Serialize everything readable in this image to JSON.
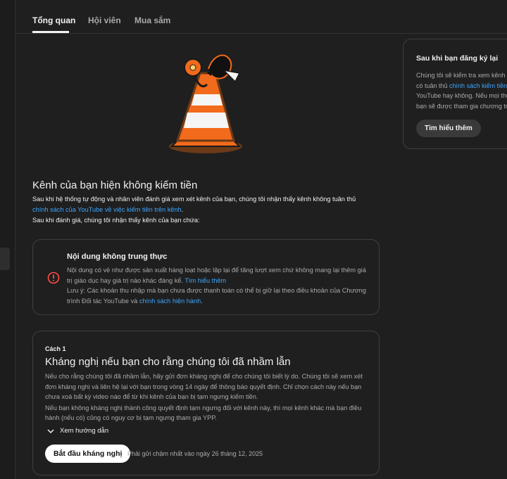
{
  "tabs": [
    {
      "label": "Tổng quan",
      "active": true
    },
    {
      "label": "Hội viên",
      "active": false
    },
    {
      "label": "Mua sắm",
      "active": false
    }
  ],
  "status": {
    "title": "Kênh của bạn hiện không kiếm tiền",
    "line1": "Sau khi hệ thống tự động và nhân viên đánh giá xem xét kênh của bạn, chúng tôi nhận thấy kênh không tuân thủ",
    "policy_link": "chính sách của YouTube về việc kiếm tiền trên kênh",
    "line1_end": ".",
    "line2": "Sau khi đánh giá, chúng tôi nhận thấy kênh của bạn chứa:"
  },
  "violation": {
    "icon": "error-circle-icon",
    "title": "Nội dung không trung thực",
    "body": "Nội dung có vẻ như được sản xuất hàng loạt hoặc lặp lại để tăng lượt xem chứ không mang lại thêm giá trị giáo dục hay giá trị nào khác đáng kể.",
    "learn_more": "Tìm hiểu thêm",
    "note": "Lưu ý: Các khoản thu nhập mà bạn chưa được thanh toán có thể bị giữ lại theo điều khoản của Chương trình Đối tác YouTube và",
    "note_link": "chính sách hiện hành",
    "note_end": "."
  },
  "appeal": {
    "step": "Cách 1",
    "title": "Kháng nghị nếu bạn cho rằng chúng tôi đã nhầm lẫn",
    "para1": "Nếu cho rằng chúng tôi đã nhầm lẫn, hãy gửi đơn kháng nghị để cho chúng tôi biết lý do. Chúng tôi sẽ xem xét đơn kháng nghị và liên hệ lại với bạn trong vòng 14 ngày để thông báo quyết định. Chỉ chọn cách này nếu bạn chưa xoá bất kỳ video nào để từ khi kênh của bạn bị tạm ngưng kiếm tiền.",
    "para2": "Nếu bạn không kháng nghị thành công quyết định tạm ngưng đối với kênh này, thì mọi kênh khác mà bạn điều hành (nếu có) cũng có nguy cơ bị tạm ngưng tham gia YPP.",
    "guide_label": "Xem hướng dẫn",
    "button_label": "Bắt đầu kháng nghị",
    "deadline": "Phải gửi chậm nhất vào ngày 26 tháng 12, 2025"
  },
  "side": {
    "title": "Sau khi bạn đăng ký lại",
    "line1": "Chúng tôi sẽ kiểm tra xem kênh",
    "line2_pre": "có tuân thủ ",
    "line2_link": "chính sách kiếm tiền",
    "line3": "YouTube hay không. Nếu mọi thứ",
    "line4": "bạn sẽ được tham gia chương trình",
    "button_label": "Tìm hiểu thêm"
  },
  "colors": {
    "background": "#1f1f1f",
    "link": "#3ea6ff",
    "error": "#ff4e45",
    "cone_orange": "#f26a1b"
  }
}
